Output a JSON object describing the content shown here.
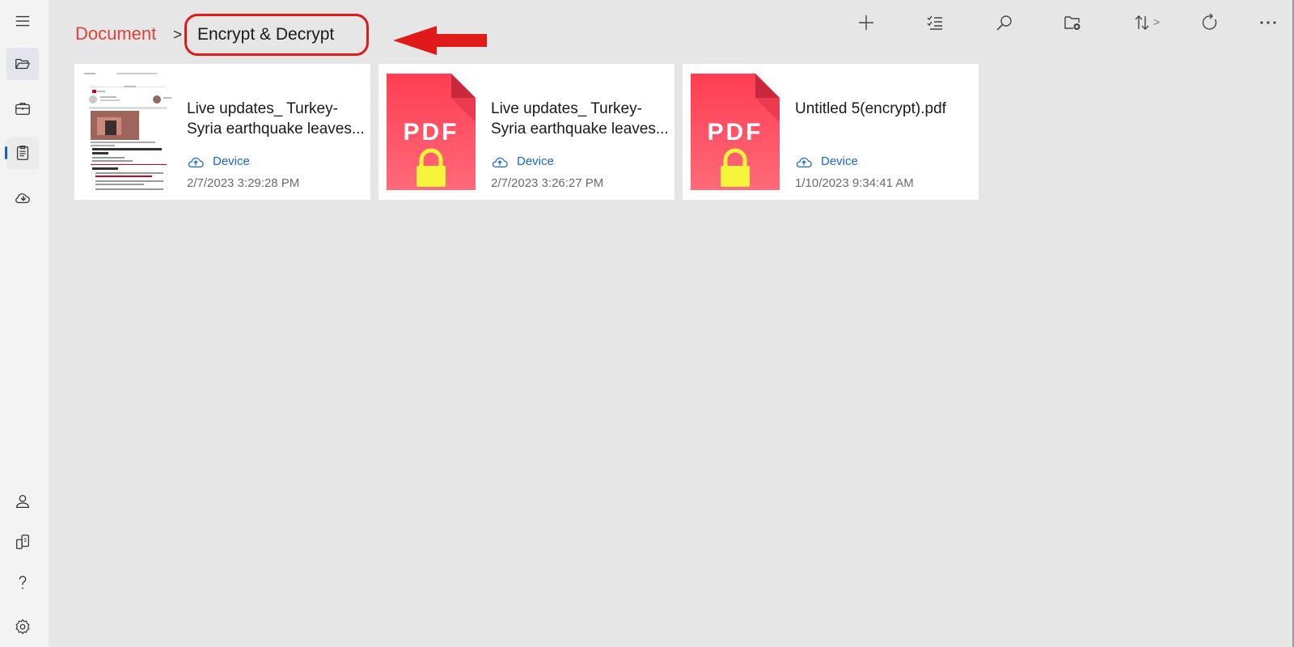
{
  "sidebar": {
    "items": [
      {
        "name": "menu",
        "icon": "hamburger-icon"
      },
      {
        "name": "open-files",
        "icon": "folder-open-icon"
      },
      {
        "name": "tools",
        "icon": "briefcase-icon"
      },
      {
        "name": "document",
        "icon": "clipboard-list-icon"
      },
      {
        "name": "cloud",
        "icon": "cloud-download-icon"
      },
      {
        "name": "account",
        "icon": "user-icon"
      },
      {
        "name": "devices",
        "icon": "phone-transfer-icon"
      },
      {
        "name": "help",
        "icon": "help-icon"
      },
      {
        "name": "settings",
        "icon": "gear-icon"
      }
    ]
  },
  "breadcrumb": {
    "root": "Document",
    "separator": ">",
    "current": "Encrypt & Decrypt"
  },
  "toolbar": {
    "buttons": [
      "add-icon",
      "checklist-icon",
      "search-icon",
      "new-folder-icon",
      "sort-icon",
      "refresh-icon",
      "more-icon"
    ],
    "sort_chevron": ">"
  },
  "files": [
    {
      "name": "Live updates_ Turkey-Syria earthquake leaves...",
      "location": "Device",
      "date": "2/7/2023 3:29:28 PM",
      "thumbnail": "document-preview"
    },
    {
      "name": "Live updates_ Turkey-Syria earthquake leaves...",
      "location": "Device",
      "date": "2/7/2023 3:26:27 PM",
      "thumbnail": "locked-pdf-icon"
    },
    {
      "name": "Untitled 5(encrypt).pdf",
      "location": "Device",
      "date": "1/10/2023 9:34:41 AM",
      "thumbnail": "locked-pdf-icon"
    }
  ],
  "pdf_icon_label": "PDF",
  "colors": {
    "accent_red": "#e0413b",
    "annotation_red": "#e01919",
    "pdf_red": "#ff4a5d",
    "lock_yellow": "#f7f53b",
    "link_blue": "#1a66c9",
    "selected_indicator": "#1a5fb4"
  }
}
